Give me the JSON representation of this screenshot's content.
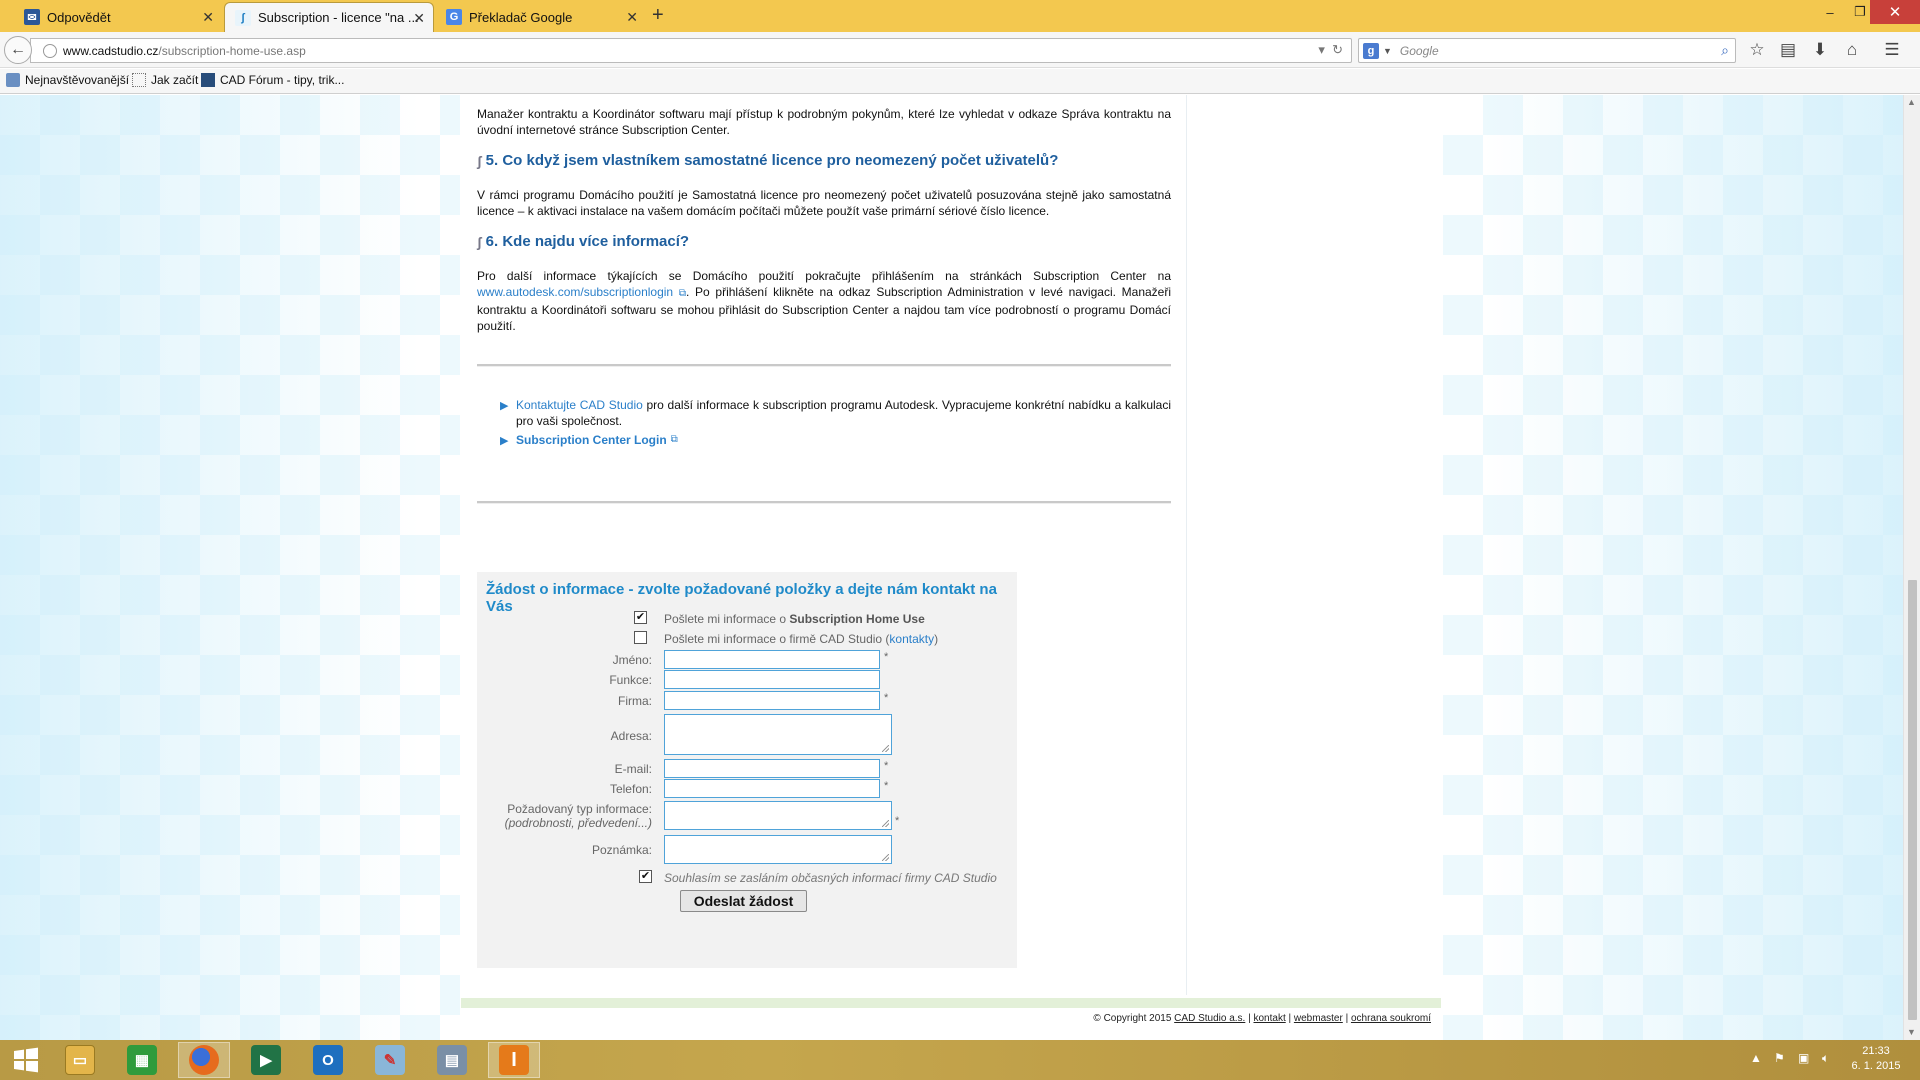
{
  "browser": {
    "tabs": [
      {
        "label": "Odpovědět",
        "icon": "mail-icon"
      },
      {
        "label": "Subscription - licence \"na ...",
        "icon": "cadstudio-icon"
      },
      {
        "label": "Překladač Google",
        "icon": "translate-icon"
      }
    ],
    "new_tab": "+",
    "window_controls": {
      "minimize": "–",
      "restore": "❐",
      "close": "✕"
    },
    "url_domain": "www.cadstudio.cz",
    "url_path": "/subscription-home-use.asp",
    "search_placeholder": "Google",
    "bookmarks": [
      {
        "label": "Nejnavštěvovanější"
      },
      {
        "label": "Jak začít"
      },
      {
        "label": "CAD Fórum - tipy, trik..."
      }
    ]
  },
  "content": {
    "intro_text": "Manažer kontraktu a Koordinátor softwaru mají přístup k podrobným pokynům, které lze vyhledat v odkaze Správa kontraktu na úvodní internetové stránce Subscription Center.",
    "section5_title": "5. Co když jsem vlastníkem samostatné licence pro neomezený počet uživatelů?",
    "section5_text": "V rámci programu Domácího použití je Samostatná licence pro neomezený počet uživatelů posuzována stejně jako samostatná licence – k aktivaci instalace na vašem domácím počítači můžete použít vaše primární sériové číslo licence.",
    "section6_title": "6. Kde najdu více informací?",
    "section6_text_a": "Pro další informace týkajících se Domácího použití pokračujte přihlášením na stránkách Subscription Center na ",
    "section6_link": "www.autodesk.com/subscriptionlogin",
    "section6_text_b": ". Po přihlášení klikněte na odkaz Subscription Administration v levé navigaci. Manažeři kontraktu a Koordinátoři softwaru se mohou přihlásit do Subscription Center a najdou tam více podrobností o programu Domácí použití.",
    "contact_link": "Kontaktujte CAD Studio",
    "contact_text": " pro další informace k subscription programu Autodesk. Vypracujeme konkrétní nabídku a kalkulaci pro vaši společnost.",
    "login_link": "Subscription Center Login"
  },
  "form": {
    "title": "Žádost o informace - zvolte požadované položky a dejte nám kontakt na Vás",
    "option1_prefix": "Pošlete mi informace o ",
    "option1_bold": "Subscription Home Use",
    "option1_checked": true,
    "option2_prefix": "Pošlete mi informace o firmě CAD Studio (",
    "option2_link": "kontakty",
    "option2_suffix": ")",
    "option2_checked": false,
    "fields": {
      "name": "Jméno:",
      "function": "Funkce:",
      "company": "Firma:",
      "address": "Adresa:",
      "email": "E-mail:",
      "phone": "Telefon:",
      "info_type": "Požadovaný typ informace:",
      "info_type_hint": "(podrobnosti, předvedení...)",
      "note": "Poznámka:"
    },
    "required_mark": "*",
    "consent_text": "Souhlasím se zasláním občasných informací firmy CAD Studio",
    "consent_checked": true,
    "submit_label": "Odeslat žádost"
  },
  "footer": {
    "copyright": "© Copyright 2015 ",
    "company_link": "CAD Studio a.s.",
    "links": [
      "kontakt",
      "webmaster",
      "ochrana soukromí"
    ],
    "separator": " | "
  },
  "taskbar": {
    "apps": [
      "file-explorer-icon",
      "store-icon",
      "firefox-icon",
      "project-icon",
      "outlook-icon",
      "paint-icon",
      "calculator-icon",
      "inventor-icon"
    ],
    "time": "21:33",
    "date": "6. 1. 2015"
  },
  "colors": {
    "tabbar": "#f3c84f",
    "heading": "#1f5f9e",
    "link": "#2a7fc9",
    "form_title": "#1f8ac9",
    "input_border": "#4fa3d9"
  }
}
